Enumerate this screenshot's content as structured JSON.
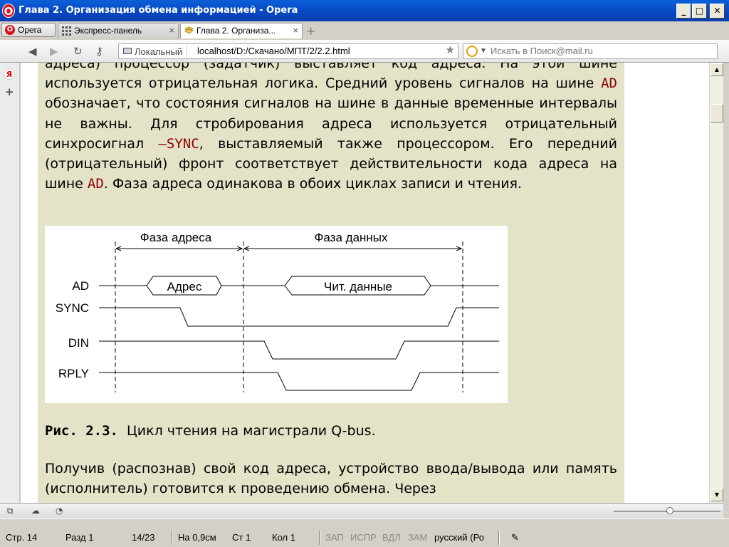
{
  "window": {
    "title": "Глава 2. Организация обмена информацией - Opera",
    "min": "_",
    "max": "□",
    "close": "✕"
  },
  "tabs": {
    "menu_label": "Opera",
    "items": [
      {
        "label": "Экспресс-панель"
      },
      {
        "label": "Глава 2. Организа..."
      }
    ]
  },
  "address": {
    "badge": "Локальный",
    "url": "localhost/D:/Скачано/МПТ/2/2.2.html",
    "search_placeholder": "Искать в Поиск@mail.ru"
  },
  "doc": {
    "p1": [
      {
        "t": "адреса) процессор (задатчик) выставляет код адреса. На этой шине используется отрицательная логика. Средний уровень сигналов на шине "
      },
      {
        "t": "AD",
        "code": true
      },
      {
        "t": " обозначает, что состояния сигналов на шине в данные временные интервалы не важны. Для стробирования адреса используется отрицательный синхросигнал "
      },
      {
        "t": "–SYNC",
        "code": true
      },
      {
        "t": ", выставляемый также процессором. Его передний (отрицательный) фронт соответствует действительности кода адреса на шине "
      },
      {
        "t": "AD",
        "code": true
      },
      {
        "t": ". Фаза адреса одинакова в обоих циклах записи и чтения."
      }
    ],
    "figure": {
      "phase_address": "Фаза адреса",
      "phase_data": "Фаза данных",
      "signals": [
        "AD",
        "SYNC",
        "DIN",
        "RPLY"
      ],
      "address_box": "Адрес",
      "data_box": "Чит. данные"
    },
    "caption_num": "Рис. 2.3.",
    "caption_text": "Цикл чтения на магистрали Q-bus.",
    "p2": "Получив (распознав) свой код адреса, устройство ввода/вывода или память (исполнитель) готовится к проведению обмена. Через"
  },
  "statusbar": {
    "page": "Стр. 14",
    "section": "Разд 1",
    "pages": "14/23",
    "at": "На 0,9см",
    "line": "Ст 1",
    "col": "Кол 1",
    "rec": "ЗАП",
    "trk": "ИСПР",
    "ext": "ВДЛ",
    "ovr": "ЗАМ",
    "lang": "русский (Ро"
  },
  "colors": {
    "page_bg": "#e4e3c8",
    "code": "#8b0000",
    "titlebar": "#0846c2"
  }
}
